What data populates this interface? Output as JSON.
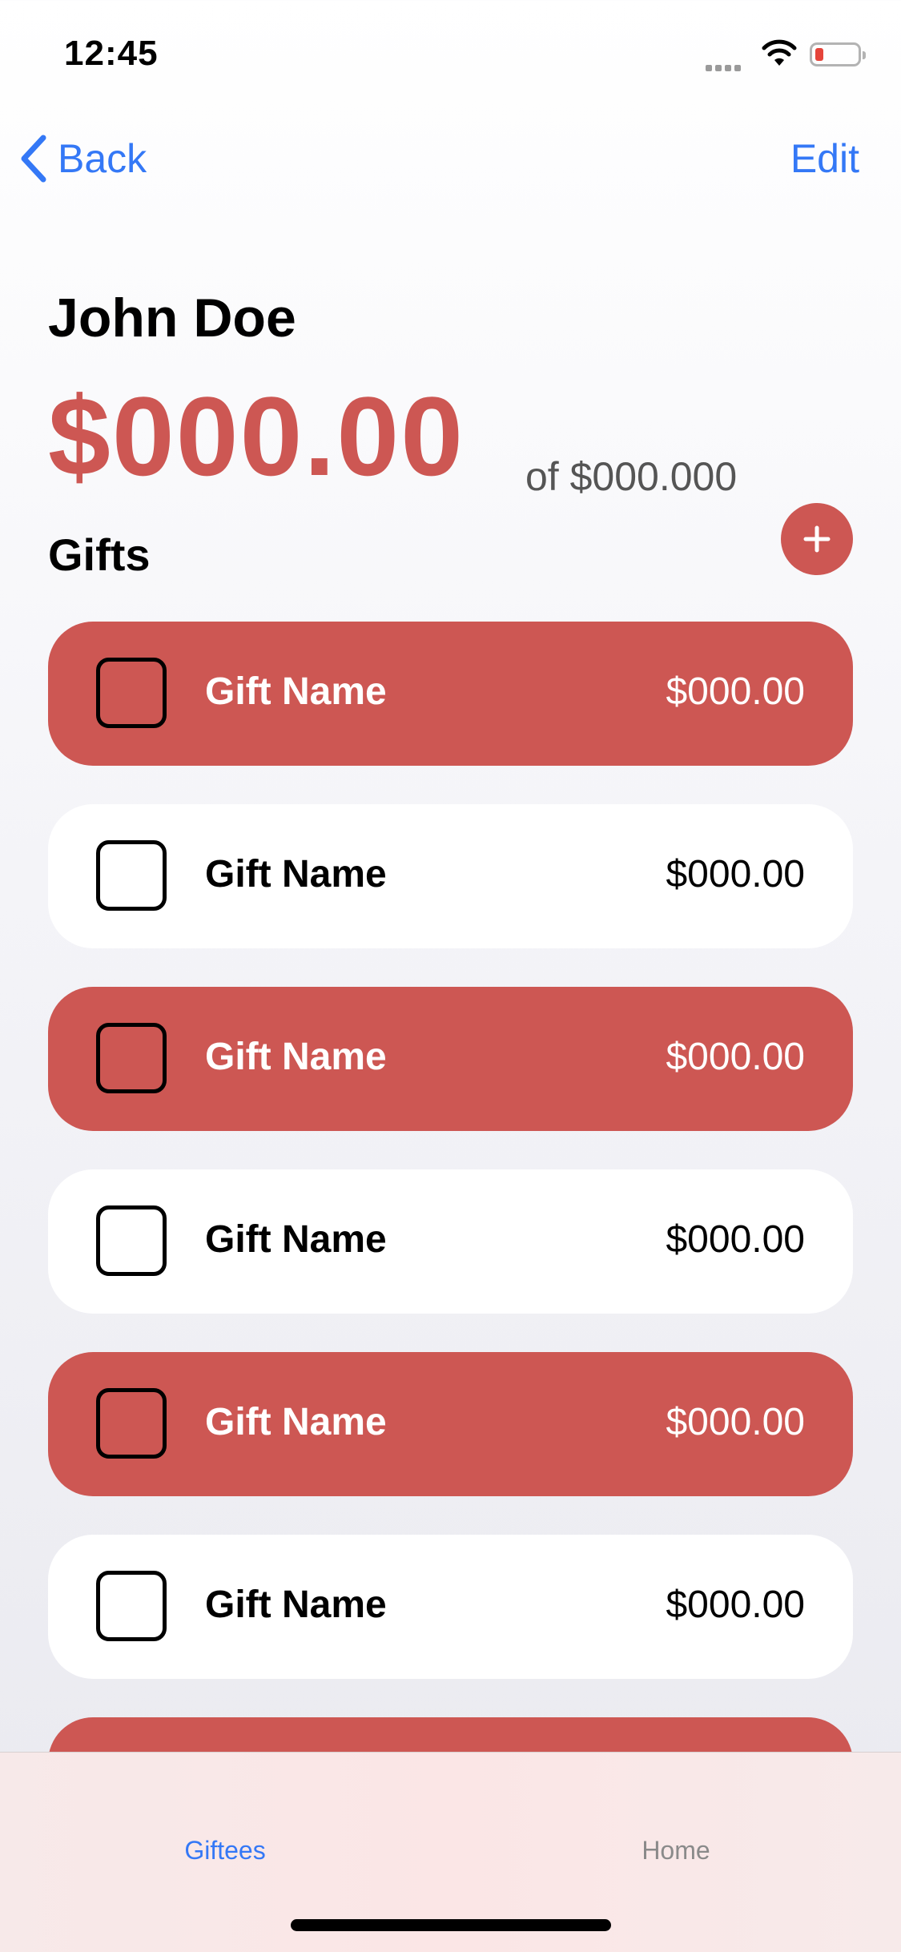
{
  "status_bar": {
    "time": "12:45",
    "icons": [
      "cellular-signal-icon",
      "wifi-icon",
      "battery-low-icon"
    ],
    "battery_color": "#e5443a"
  },
  "nav": {
    "back_label": "Back",
    "edit_label": "Edit",
    "accent_color": "#3478f6"
  },
  "giftee": {
    "name": "John Doe",
    "spent": "$000.00",
    "budget": "of $000.000",
    "accent_color": "#cd5753"
  },
  "gifts_section": {
    "title": "Gifts",
    "add_icon": "plus-icon"
  },
  "gifts": [
    {
      "name": "Gift Name",
      "price": "$000.00",
      "style": "red"
    },
    {
      "name": "Gift Name",
      "price": "$000.00",
      "style": "white"
    },
    {
      "name": "Gift Name",
      "price": "$000.00",
      "style": "red"
    },
    {
      "name": "Gift Name",
      "price": "$000.00",
      "style": "white"
    },
    {
      "name": "Gift Name",
      "price": "$000.00",
      "style": "red"
    },
    {
      "name": "Gift Name",
      "price": "$000.00",
      "style": "white"
    },
    {
      "name": "",
      "price": "",
      "style": "red"
    }
  ],
  "tab_bar": {
    "tabs": [
      {
        "label": "Giftees",
        "selected": true
      },
      {
        "label": "Home",
        "selected": false
      }
    ]
  }
}
